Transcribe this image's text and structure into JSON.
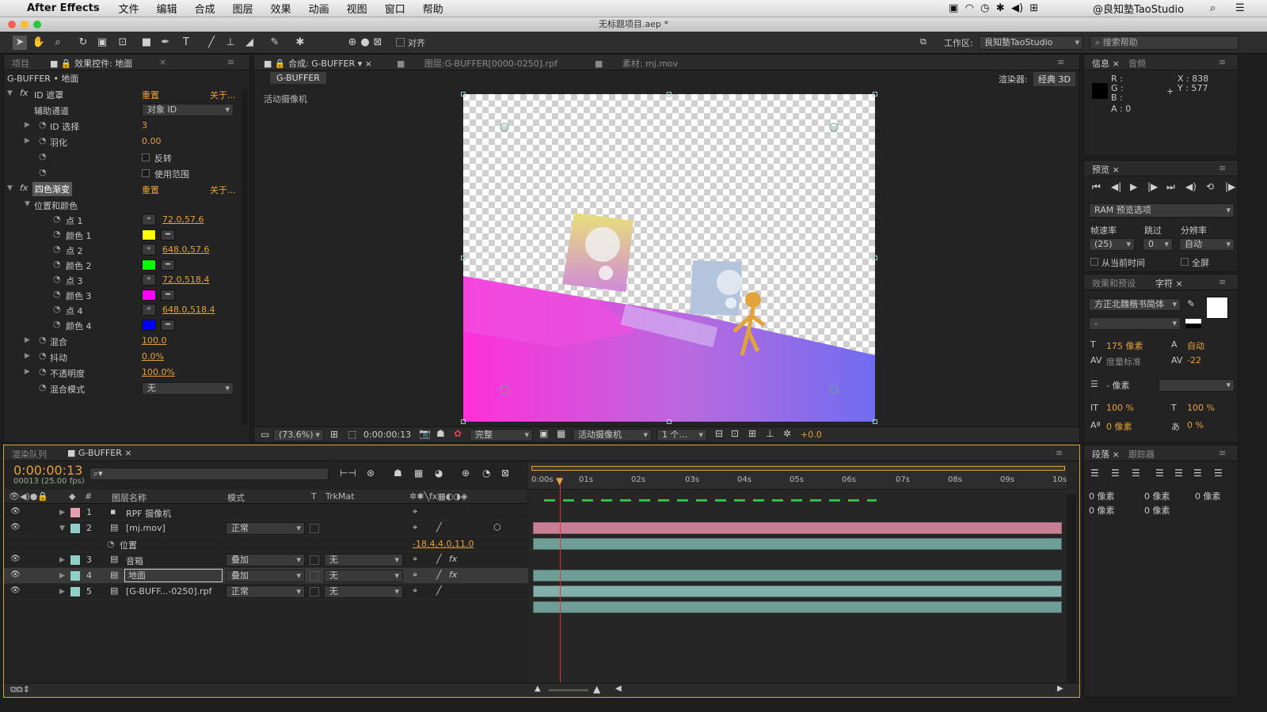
{
  "menubar": {
    "app": "After Effects",
    "items": [
      "文件",
      "编辑",
      "合成",
      "图层",
      "效果",
      "动画",
      "视图",
      "窗口",
      "帮助"
    ],
    "user": "@良知塾TaoStudio"
  },
  "titlebar": {
    "title": "无标题项目.aep *"
  },
  "toolbar": {
    "align": "对齐",
    "workspace_label": "工作区:",
    "workspace_value": "良知塾TaoStudio",
    "search_placeholder": "搜索帮助"
  },
  "project": {
    "tab_project": "项目",
    "tab_effects": "效果控件: 地面",
    "breadcrumb": "G-BUFFER • 地面"
  },
  "effects": {
    "id_matte": {
      "name": "ID 遮罩",
      "reset": "重置",
      "about": "关于...",
      "aux_label": "辅助通道",
      "aux_value": "对象 ID",
      "id_sel_label": "ID 选择",
      "id_sel_value": "3",
      "feather_label": "羽化",
      "feather_value": "0.00",
      "invert_label": "反转",
      "use_range_label": "使用范围"
    },
    "four_color": {
      "name": "四色渐变",
      "reset": "重置",
      "about": "关于...",
      "pos_group": "位置和颜色",
      "p1_label": "点 1",
      "p1_value": "72.0,57.6",
      "c1_label": "颜色 1",
      "p2_label": "点 2",
      "p2_value": "648.0,57.6",
      "c2_label": "颜色 2",
      "p3_label": "点 3",
      "p3_value": "72.0,518.4",
      "c3_label": "颜色 3",
      "p4_label": "点 4",
      "p4_value": "648.0,518.4",
      "c4_label": "颜色 4",
      "blend_label": "混合",
      "blend_value": "100.0",
      "jitter_label": "抖动",
      "jitter_value": "0.0%",
      "opacity_label": "不透明度",
      "opacity_value": "100.0%",
      "mode_label": "混合模式",
      "mode_value": "无"
    },
    "colors": {
      "c1": "#ffff00",
      "c2": "#00ff00",
      "c3": "#ff00ff",
      "c4": "#0000ff"
    }
  },
  "comp": {
    "tab_comp": "合成: G-BUFFER",
    "tab_layer": "图层:G-BUFFER[0000-0250].rpf",
    "tab_footage": "素材: mj.mov",
    "crumb": "G-BUFFER",
    "renderer_label": "渲染器:",
    "renderer_value": "经典 3D",
    "camera_label": "活动摄像机",
    "zoom": "(73.6%)",
    "timecode": "0:00:00:13",
    "quality": "完整",
    "view": "活动摄像机",
    "views": "1 个...",
    "exposure": "+0.0"
  },
  "info": {
    "tab": "信息",
    "tab_audio": "音频",
    "r": "R :",
    "g": "G :",
    "b": "B :",
    "a": "A : 0",
    "x": "X : 838",
    "y": "Y : 577"
  },
  "preview": {
    "tab": "预览",
    "ram": "RAM 预览选项",
    "fps_label": "帧速率",
    "skip_label": "跳过",
    "res_label": "分辨率",
    "fps_value": "(25)",
    "skip_value": "0",
    "res_value": "自动",
    "from_current": "从当前时间",
    "fullscreen": "全屏"
  },
  "character": {
    "tab_effects": "效果和预设",
    "tab_char": "字符",
    "font": "方正北魏楷书简体",
    "style": "-",
    "size": "175 像素",
    "leading": "自动",
    "kerning": "度量标准",
    "tracking": "-22",
    "stroke": "- 像素",
    "vscale": "100 %",
    "hscale": "100 %",
    "baseline": "0 像素",
    "tsume": "0 %"
  },
  "paragraph": {
    "tab": "段落",
    "tab_tracker": "跟踪器",
    "i1": "0 像素",
    "i2": "0 像素",
    "i3": "0 像素",
    "i4": "0 像素",
    "i5": "0 像素"
  },
  "timeline": {
    "tab_render": "渲染队列",
    "tab_comp": "G-BUFFER",
    "timecode": "0:00:00:13",
    "frames": "00013 (25.00 fps)",
    "col_name": "图层名称",
    "col_mode": "模式",
    "col_t": "T",
    "col_trkmat": "TrkMat",
    "col_num": "#",
    "ruler": [
      "0:00s",
      "01s",
      "02s",
      "03s",
      "04s",
      "05s",
      "06s",
      "07s",
      "08s",
      "09s",
      "10s"
    ],
    "layers": [
      {
        "num": "1",
        "name": "RPF 摄像机",
        "mode": "",
        "trk": "",
        "color": "#e8a0b0"
      },
      {
        "num": "2",
        "name": "[mj.mov]",
        "mode": "正常",
        "trk": "",
        "color": "#8fd0c8"
      },
      {
        "num": "3",
        "name": "音箱",
        "mode": "叠加",
        "trk": "无",
        "color": "#8fd0c8"
      },
      {
        "num": "4",
        "name": "地面",
        "mode": "叠加",
        "trk": "无",
        "color": "#8fd0c8"
      },
      {
        "num": "5",
        "name": "[G-BUFF...-0250].rpf",
        "mode": "正常",
        "trk": "无",
        "color": "#8fd0c8"
      }
    ],
    "position_label": "位置",
    "position_value": "-18.4,4.0,11.0"
  }
}
